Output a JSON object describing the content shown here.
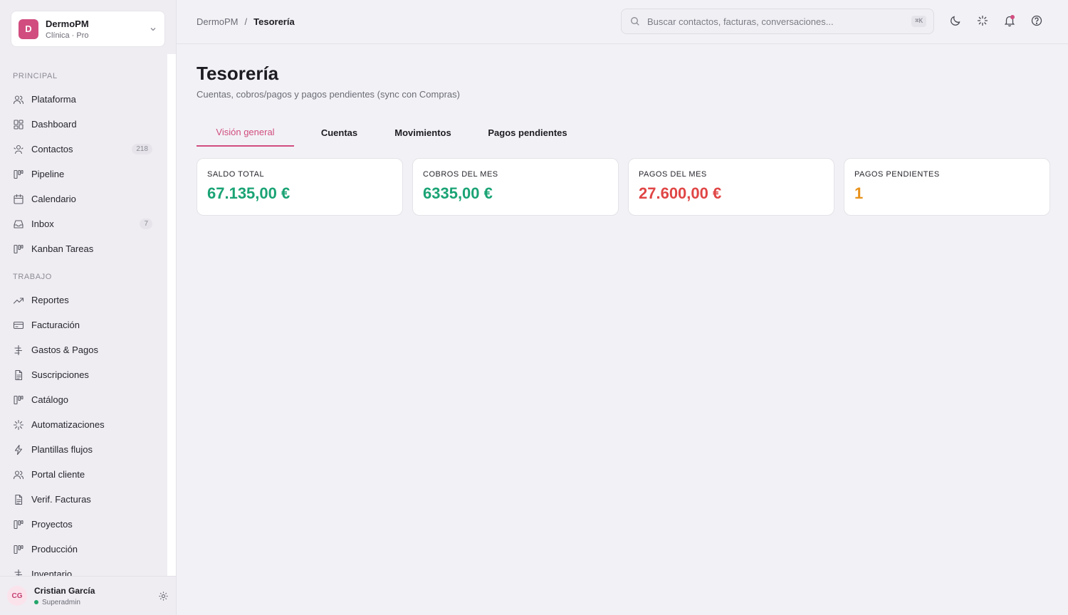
{
  "org": {
    "logo_letter": "D",
    "name": "DermoPM",
    "subtitle": "Clínica · Pro"
  },
  "sidebar": {
    "sections": [
      {
        "label": "PRINCIPAL",
        "items": [
          {
            "label": "Plataforma",
            "icon": "users-icon"
          },
          {
            "label": "Dashboard",
            "icon": "grid-icon"
          },
          {
            "label": "Contactos",
            "icon": "contacts-icon",
            "badge": "218"
          },
          {
            "label": "Pipeline",
            "icon": "kanban-icon"
          },
          {
            "label": "Calendario",
            "icon": "calendar-icon"
          },
          {
            "label": "Inbox",
            "icon": "inbox-icon",
            "badge": "7"
          },
          {
            "label": "Kanban Tareas",
            "icon": "kanban-icon"
          }
        ]
      },
      {
        "label": "TRABAJO",
        "items": [
          {
            "label": "Reportes",
            "icon": "trend-icon"
          },
          {
            "label": "Facturación",
            "icon": "card-icon"
          },
          {
            "label": "Gastos & Pagos",
            "icon": "currency-icon"
          },
          {
            "label": "Suscripciones",
            "icon": "document-icon"
          },
          {
            "label": "Catálogo",
            "icon": "kanban-icon"
          },
          {
            "label": "Automatizaciones",
            "icon": "sparkle-icon"
          },
          {
            "label": "Plantillas flujos",
            "icon": "bolt-icon"
          },
          {
            "label": "Portal cliente",
            "icon": "users-icon"
          },
          {
            "label": "Verif. Facturas",
            "icon": "document-icon"
          },
          {
            "label": "Proyectos",
            "icon": "kanban-icon"
          },
          {
            "label": "Producción",
            "icon": "kanban-icon"
          },
          {
            "label": "Inventario",
            "icon": "currency-icon"
          }
        ]
      }
    ]
  },
  "user": {
    "initials": "CG",
    "name": "Cristian García",
    "role": "Superadmin"
  },
  "header": {
    "breadcrumb": [
      "DermoPM",
      "Tesorería"
    ],
    "search_placeholder": "Buscar contactos, facturas, conversaciones...",
    "shortcut": "⌘K"
  },
  "page": {
    "title": "Tesorería",
    "subtitle": "Cuentas, cobros/pagos y pagos pendientes (sync con Compras)"
  },
  "tabs": [
    {
      "label": "Visión general",
      "active": true
    },
    {
      "label": "Cuentas",
      "active": false
    },
    {
      "label": "Movimientos",
      "active": false
    },
    {
      "label": "Pagos pendientes",
      "active": false
    }
  ],
  "cards": [
    {
      "label": "SALDO TOTAL",
      "value": "67.135,00 €",
      "color": "#1aa374"
    },
    {
      "label": "COBROS DEL MES",
      "value": "6335,00 €",
      "color": "#1aa374"
    },
    {
      "label": "PAGOS DEL MES",
      "value": "27.600,00 €",
      "color": "#e04545"
    },
    {
      "label": "PAGOS PENDIENTES",
      "value": "1",
      "color": "#e8921a"
    }
  ],
  "colors": {
    "accent": "#d14d7f",
    "positive": "#1aa374",
    "negative": "#e04545",
    "warning": "#e8921a"
  }
}
